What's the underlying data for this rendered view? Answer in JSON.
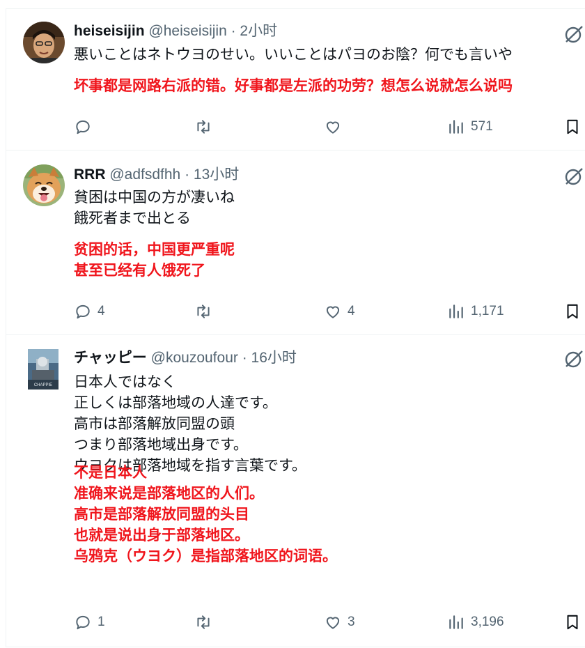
{
  "colors": {
    "translation": "#f0151c",
    "meta": "#536471",
    "divider": "#eff3f4"
  },
  "icons": [
    "reply-icon",
    "retweet-icon",
    "like-icon",
    "views-icon",
    "bookmark-icon",
    "grok-icon"
  ],
  "tweets": [
    {
      "name": "heiseisijin",
      "handle": "@heiseisijin",
      "time": "· 2小时",
      "text": [
        "悪いことはネトウヨのせい。いいことはパヨのお陰？何でも言いや"
      ],
      "translation": [
        "坏事都是网路右派的错。好事都是左派的功劳？想怎么说就怎么说吗"
      ],
      "replies": "",
      "retweets": "",
      "likes": "",
      "views": "571"
    },
    {
      "name": "RRR",
      "handle": "@adfsdfhh",
      "time": "· 13小时",
      "text": [
        "貧困は中国の方が凄いね",
        "餓死者まで出とる"
      ],
      "translation": [
        "贫困的话，中国更严重呢",
        "甚至已经有人饿死了"
      ],
      "replies": "4",
      "retweets": "",
      "likes": "4",
      "views": "1,171"
    },
    {
      "name": "チャッピー",
      "handle": "@kouzoufour",
      "time": "· 16小时",
      "avatar_caption": "CHAPPIE",
      "text": [
        "日本人ではなく",
        "正しくは部落地域の人達です。",
        "高市は部落解放同盟の頭",
        "つまり部落地域出身です。",
        "ウヨクは部落地域を指す言葉です。"
      ],
      "translation": [
        "不是日本人",
        "准确来说是部落地区的人们。",
        "高市是部落解放同盟的头目",
        "也就是说出身于部落地区。",
        "乌鸦克（ウヨク）是指部落地区的词语。"
      ],
      "replies": "1",
      "retweets": "",
      "likes": "3",
      "views": "3,196"
    }
  ]
}
